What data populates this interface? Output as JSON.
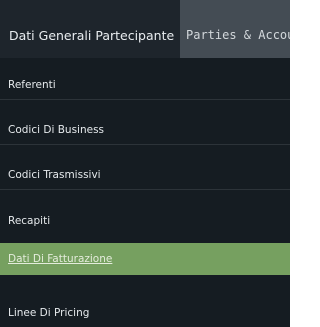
{
  "tabs": {
    "active_label": "Dati Generali Partecipante",
    "inactive_label": "Parties & Accou"
  },
  "sidebar": {
    "items": [
      {
        "label": "Referenti"
      },
      {
        "label": "Codici Di Business"
      },
      {
        "label": "Codici Trasmissivi"
      },
      {
        "label": "Recapiti"
      },
      {
        "label": "Dati Di Fatturazione",
        "selected": true
      },
      {
        "label": "Linee Di Pricing"
      }
    ]
  },
  "colors": {
    "tab_bar": "#1e252c",
    "inactive_tab": "#444c54",
    "sidebar": "#151c22",
    "selected_item": "#76a060"
  }
}
